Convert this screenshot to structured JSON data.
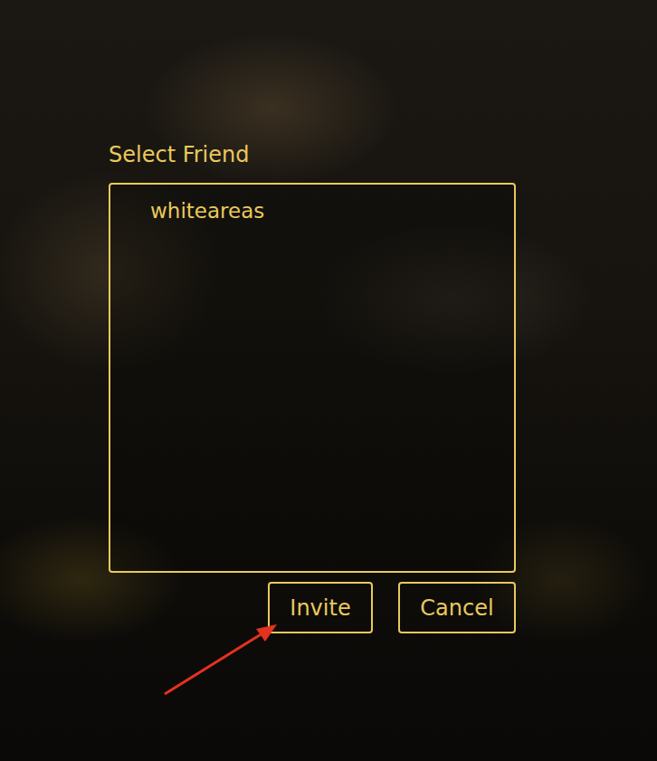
{
  "dialog": {
    "title": "Select Friend"
  },
  "friends": [
    {
      "name": "whiteareas",
      "selected": false
    }
  ],
  "buttons": [
    "Invite",
    "Cancel"
  ]
}
